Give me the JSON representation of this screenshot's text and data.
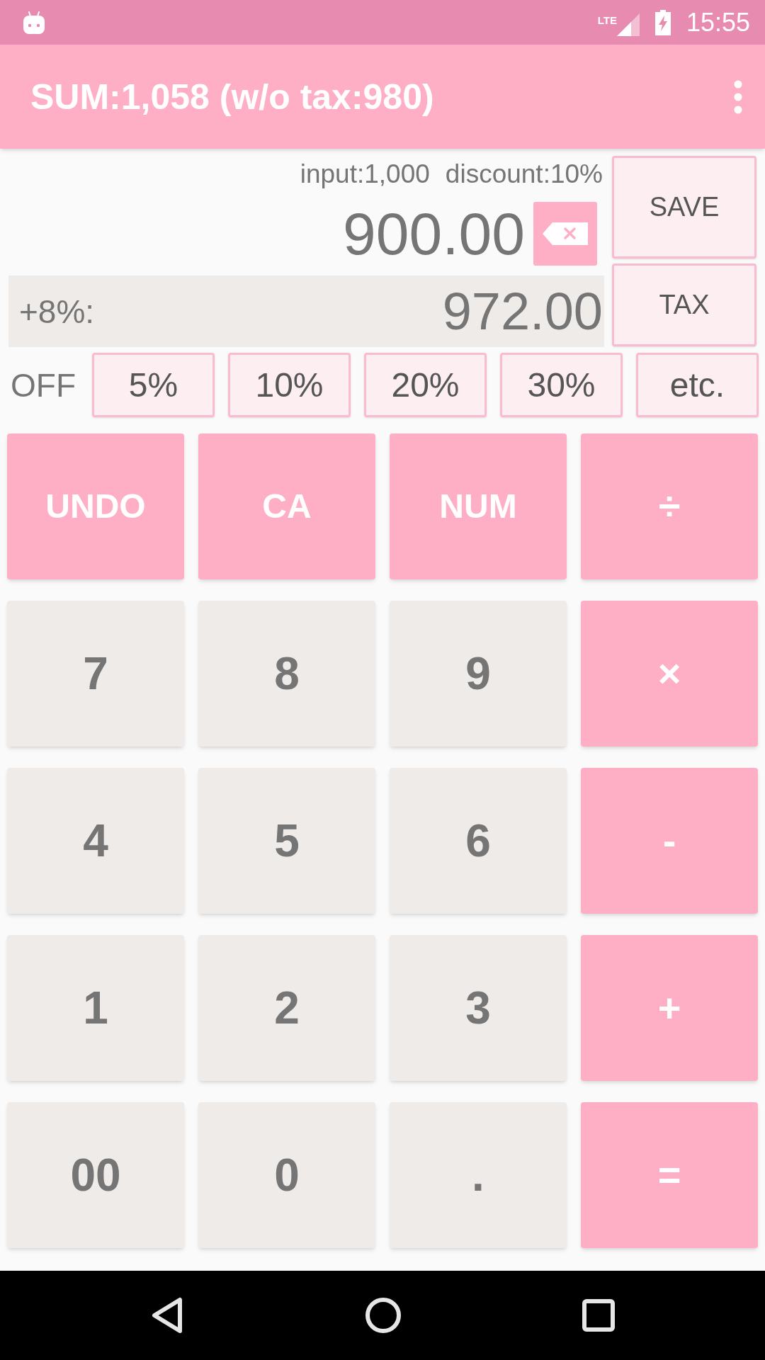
{
  "status_bar": {
    "network": "LTE",
    "time": "15:55"
  },
  "app_bar": {
    "title": "SUM:1,058 (w/o tax:980)"
  },
  "display": {
    "info": [
      "input:1,000",
      "discount:10%"
    ],
    "value": "900.00",
    "tax_label": "+8%:",
    "tax_value": "972.00"
  },
  "side_buttons": [
    "SAVE",
    "TAX"
  ],
  "discount": {
    "label": "OFF",
    "options": [
      "5%",
      "10%",
      "20%",
      "30%",
      "etc."
    ]
  },
  "keypad": [
    {
      "label": "UNDO",
      "kind": "function"
    },
    {
      "label": "CA",
      "kind": "function"
    },
    {
      "label": "NUM",
      "kind": "function"
    },
    {
      "label": "÷",
      "kind": "operator"
    },
    {
      "label": "7",
      "kind": "digit"
    },
    {
      "label": "8",
      "kind": "digit"
    },
    {
      "label": "9",
      "kind": "digit"
    },
    {
      "label": "×",
      "kind": "operator"
    },
    {
      "label": "4",
      "kind": "digit"
    },
    {
      "label": "5",
      "kind": "digit"
    },
    {
      "label": "6",
      "kind": "digit"
    },
    {
      "label": "-",
      "kind": "operator"
    },
    {
      "label": "1",
      "kind": "digit"
    },
    {
      "label": "2",
      "kind": "digit"
    },
    {
      "label": "3",
      "kind": "digit"
    },
    {
      "label": "+",
      "kind": "operator"
    },
    {
      "label": "00",
      "kind": "digit"
    },
    {
      "label": "0",
      "kind": "digit"
    },
    {
      "label": ".",
      "kind": "digit"
    },
    {
      "label": "=",
      "kind": "operator"
    }
  ]
}
